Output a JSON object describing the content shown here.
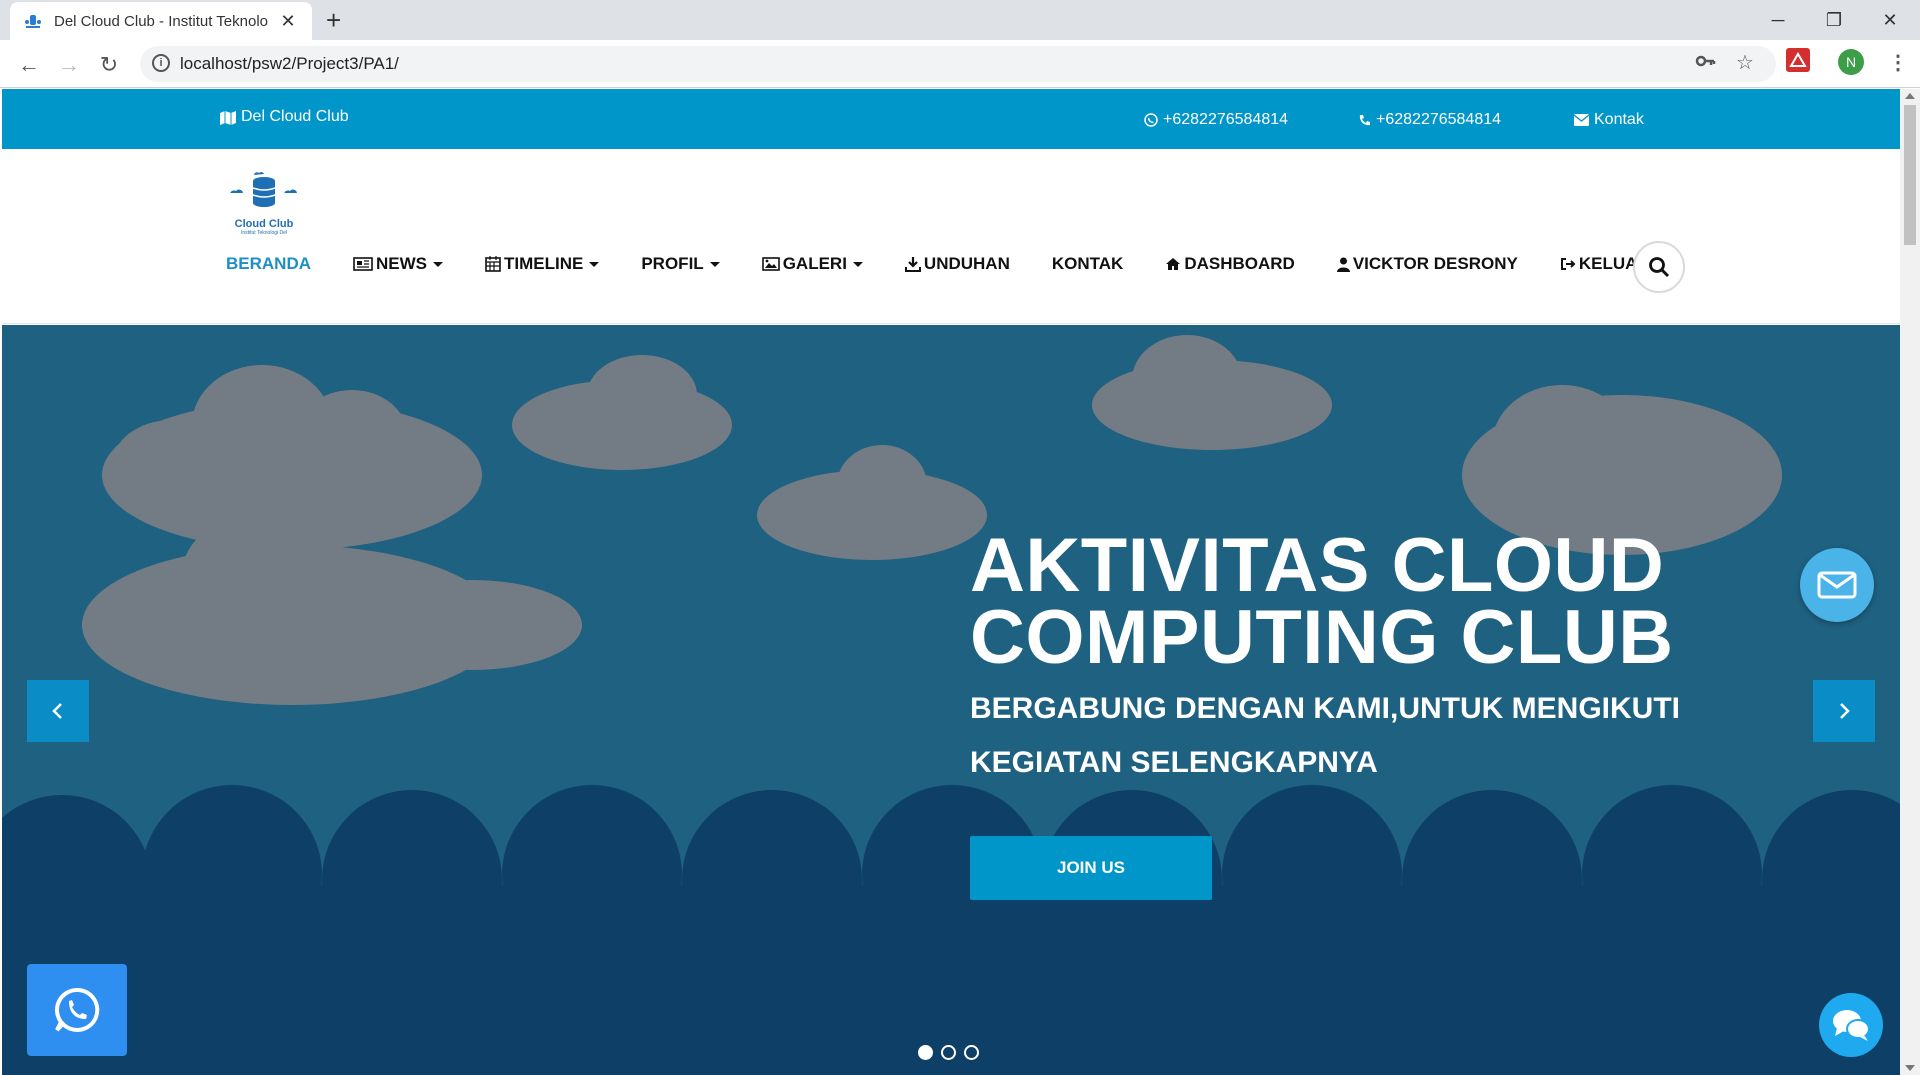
{
  "browser": {
    "tab_title": "Del Cloud Club - Institut Teknolo",
    "url": "localhost/psw2/Project3/PA1/",
    "profile_initial": "N"
  },
  "topbar": {
    "brand": "Del Cloud Club",
    "whatsapp": "+6282276584814",
    "phone": "+6282276584814",
    "contact": "Kontak"
  },
  "logo": {
    "text": "Cloud Club",
    "subtext": "Institut Teknologi Del"
  },
  "nav": {
    "items": [
      {
        "label": "BERANDA",
        "icon": ""
      },
      {
        "label": "NEWS",
        "icon": "newspaper-icon"
      },
      {
        "label": "TIMELINE",
        "icon": "calendar-icon"
      },
      {
        "label": "PROFIL",
        "icon": ""
      },
      {
        "label": "GALERI",
        "icon": "image-icon"
      },
      {
        "label": "UNDUHAN",
        "icon": "download-icon"
      },
      {
        "label": "KONTAK",
        "icon": ""
      },
      {
        "label": "DASHBOARD",
        "icon": "home-icon"
      },
      {
        "label": "VICKTOR DESRONY",
        "icon": "user-icon"
      },
      {
        "label": "KELUAR",
        "icon": "sign-out-icon"
      }
    ]
  },
  "hero": {
    "title_line1": "AKTIVITAS CLOUD",
    "title_line2": "COMPUTING CLUB",
    "subtitle_line1": "BERGABUNG DENGAN KAMI,UNTUK MENGIKUTI",
    "subtitle_line2": "KEGIATAN SELENGKAPNYA",
    "cta": "JOIN US",
    "slides": 3,
    "active_slide": 1
  },
  "colors": {
    "primary": "#0096c9",
    "hero_bg": "#1f6180",
    "active_nav": "#1e8fc6"
  }
}
